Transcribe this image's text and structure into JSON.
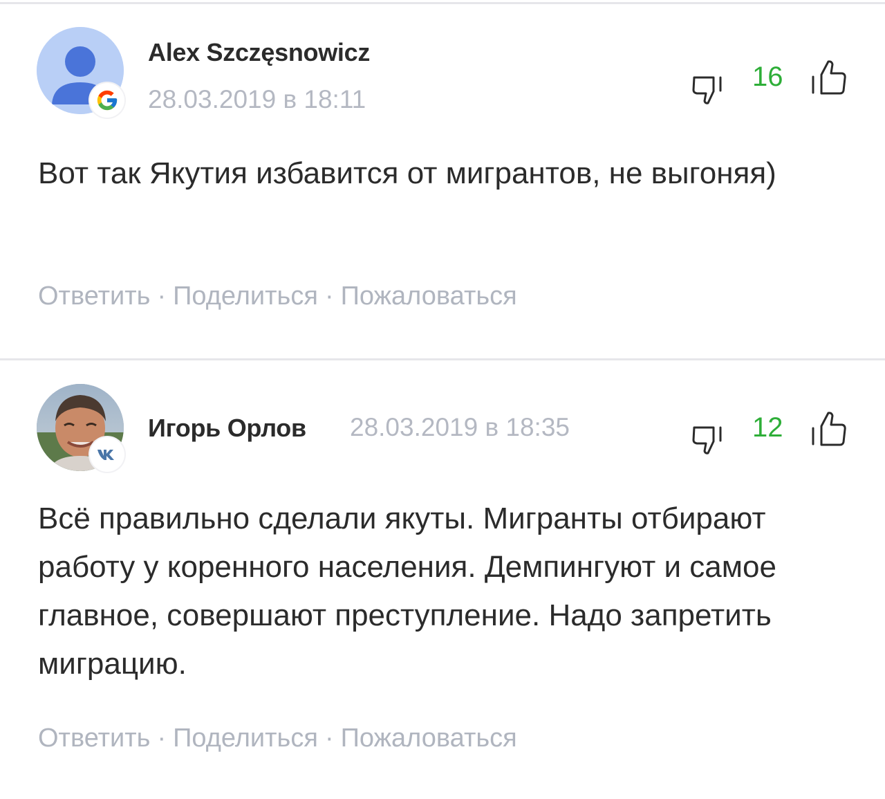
{
  "comments": [
    {
      "author": "Alex Szczęsnowicz",
      "date": "28.03.2019 в 18:11",
      "score": "16",
      "text": "Вот так Якутия избавится от мигрантов, не выгоняя)",
      "badge": "google-icon",
      "avatar": "default-user-avatar",
      "actions": {
        "reply": "Ответить",
        "share": "Поделиться",
        "report": "Пожаловаться",
        "separator": "·"
      }
    },
    {
      "author": "Игорь Орлов",
      "date": "28.03.2019 в 18:35",
      "score": "12",
      "text": "Всё правильно сделали якуты. Мигранты отбирают работу у коренного населения. Демпингуют и самое главное, совершают преступление. Надо запретить миграцию.",
      "badge": "vk-icon",
      "avatar": "user-photo-avatar",
      "actions": {
        "reply": "Ответить",
        "share": "Поделиться",
        "report": "Пожаловаться",
        "separator": "·"
      }
    }
  ],
  "colors": {
    "score_positive": "#2eae38",
    "muted": "#b0b5bf",
    "google_avatar_bg": "#b9cff6",
    "google_avatar_fg": "#4a74d9"
  }
}
